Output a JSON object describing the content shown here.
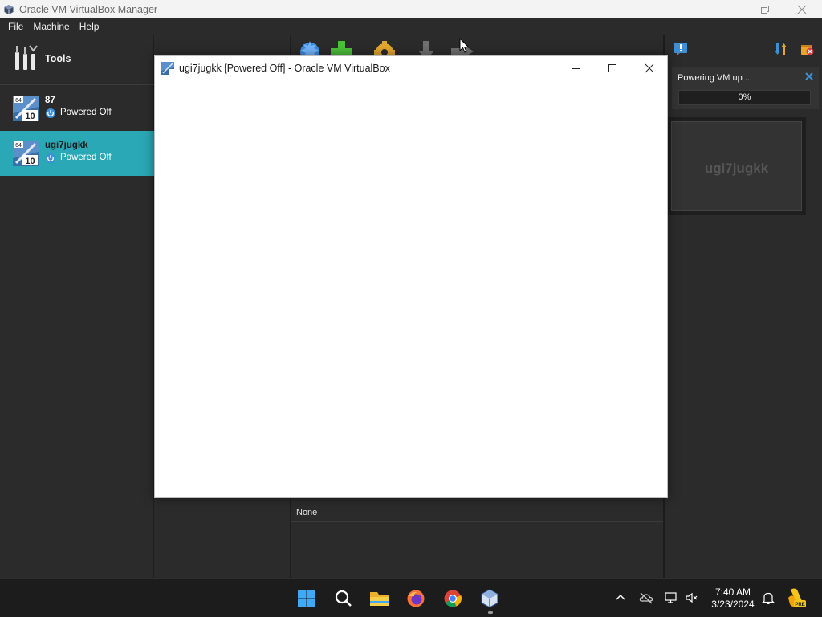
{
  "main_window": {
    "title": "Oracle VM VirtualBox Manager"
  },
  "menu": {
    "items": [
      {
        "label": "File",
        "accel": "F",
        "rest": "ile"
      },
      {
        "label": "Machine",
        "accel": "M",
        "rest": "achine"
      },
      {
        "label": "Help",
        "accel": "H",
        "rest": "elp"
      }
    ]
  },
  "left_pane": {
    "tools_label": "Tools",
    "vms": [
      {
        "name": "87",
        "state": "Powered Off",
        "os_badge_top": "64",
        "os_badge_bottom": "10",
        "selected": false
      },
      {
        "name": "ugi7jugkk",
        "state": "Powered Off",
        "os_badge_top": "64",
        "os_badge_bottom": "10",
        "selected": true
      }
    ]
  },
  "toolbar": {
    "icons": [
      "new-icon",
      "add-icon",
      "settings-icon",
      "discard-icon",
      "start-icon"
    ]
  },
  "details": {
    "value_none": "None"
  },
  "notification": {
    "title": "Powering VM up ...",
    "progress_text": "0%",
    "progress": 0
  },
  "preview": {
    "vm_name": "ugi7jugkk"
  },
  "vm_window": {
    "title": "ugi7jugkk [Powered Off] - Oracle VM VirtualBox"
  },
  "taskbar": {
    "time": "7:40 AM",
    "date": "3/23/2024",
    "apps": [
      "start-icon",
      "search-icon",
      "file-explorer-icon",
      "firefox-icon",
      "chrome-icon",
      "virtualbox-icon"
    ]
  },
  "colors": {
    "selection": "#2aa8b5",
    "background": "#2b2b2b",
    "taskbar": "#1c1c1c"
  }
}
